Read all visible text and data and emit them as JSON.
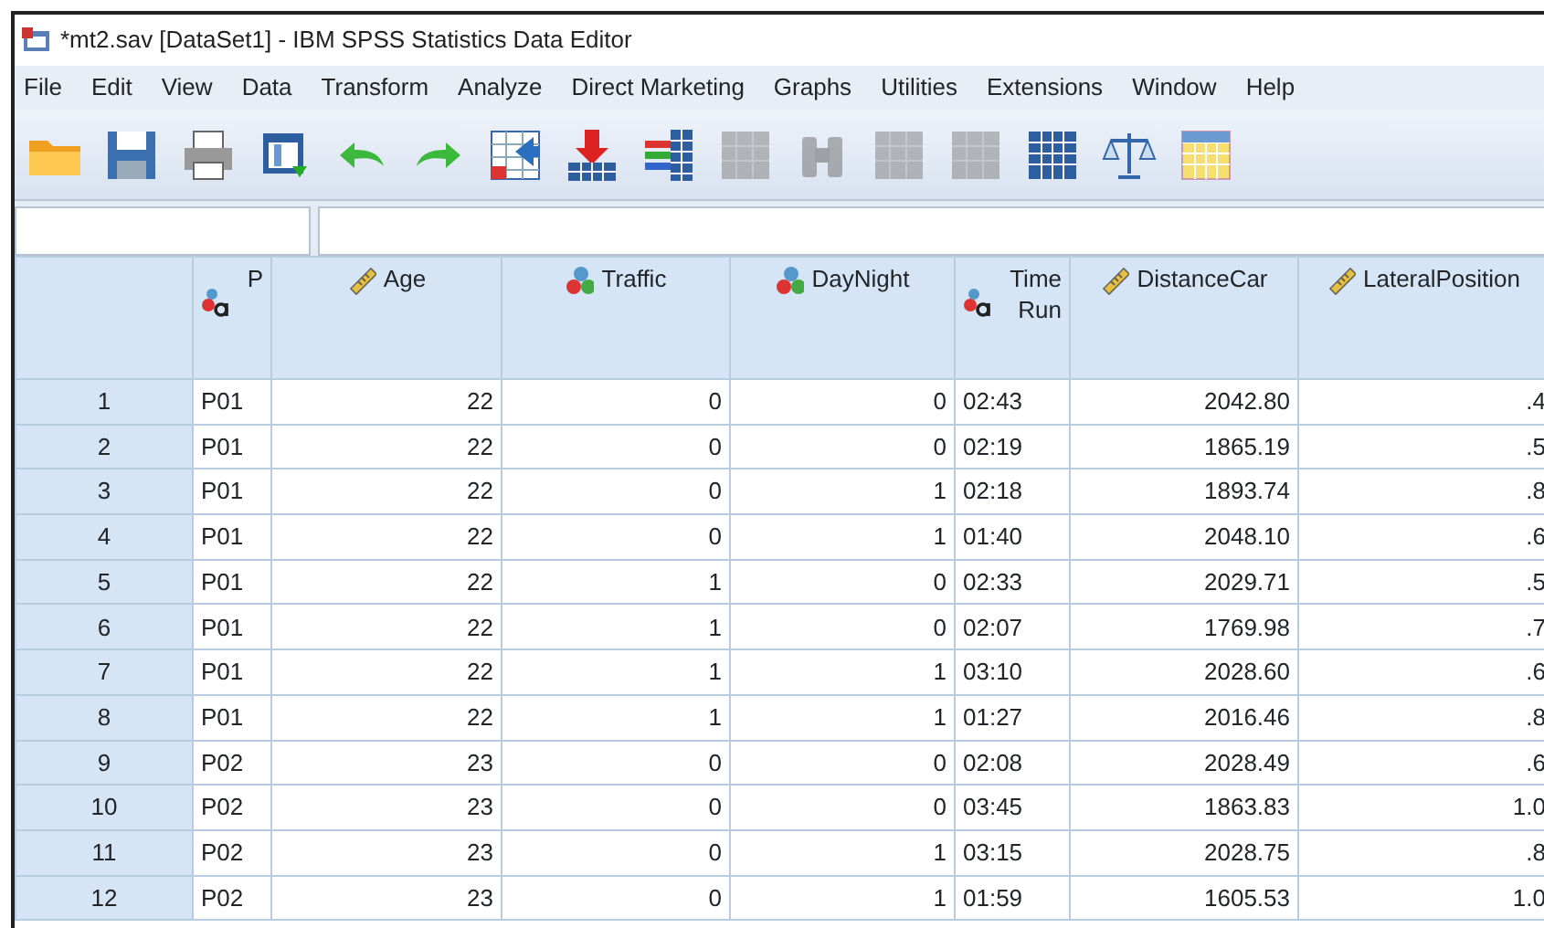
{
  "window": {
    "title": "*mt2.sav [DataSet1] - IBM SPSS Statistics Data Editor"
  },
  "menu": [
    "File",
    "Edit",
    "View",
    "Data",
    "Transform",
    "Analyze",
    "Direct Marketing",
    "Graphs",
    "Utilities",
    "Extensions",
    "Window",
    "Help"
  ],
  "toolbar": [
    {
      "kind": "folder",
      "disabled": false
    },
    {
      "kind": "save",
      "disabled": false
    },
    {
      "kind": "print",
      "disabled": false
    },
    {
      "kind": "dialog",
      "disabled": false
    },
    {
      "kind": "undo",
      "disabled": false
    },
    {
      "kind": "redo",
      "disabled": false
    },
    {
      "kind": "goto-case",
      "disabled": false
    },
    {
      "kind": "insert-cases",
      "disabled": false
    },
    {
      "kind": "variables",
      "disabled": false
    },
    {
      "kind": "grid",
      "disabled": true
    },
    {
      "kind": "find",
      "disabled": true
    },
    {
      "kind": "grid",
      "disabled": true
    },
    {
      "kind": "grid",
      "disabled": true
    },
    {
      "kind": "table",
      "disabled": false
    },
    {
      "kind": "scale",
      "disabled": false
    },
    {
      "kind": "yellow-grid",
      "disabled": false
    }
  ],
  "columns": [
    {
      "label": "P",
      "kind": "string"
    },
    {
      "label": "Age",
      "kind": "scale"
    },
    {
      "label": "Traffic",
      "kind": "nominal"
    },
    {
      "label": "DayNight",
      "kind": "nominal"
    },
    {
      "label": "Time Run",
      "kind": "string"
    },
    {
      "label": "DistanceCar",
      "kind": "scale"
    },
    {
      "label": "LateralPosition",
      "kind": "scale"
    }
  ],
  "rows": [
    {
      "number": "1",
      "cells": [
        "P01",
        "22",
        "0",
        "0",
        "02:43",
        "2042.80",
        ".4"
      ]
    },
    {
      "number": "2",
      "cells": [
        "P01",
        "22",
        "0",
        "0",
        "02:19",
        "1865.19",
        ".5"
      ]
    },
    {
      "number": "3",
      "cells": [
        "P01",
        "22",
        "0",
        "1",
        "02:18",
        "1893.74",
        ".8"
      ]
    },
    {
      "number": "4",
      "cells": [
        "P01",
        "22",
        "0",
        "1",
        "01:40",
        "2048.10",
        ".6"
      ]
    },
    {
      "number": "5",
      "cells": [
        "P01",
        "22",
        "1",
        "0",
        "02:33",
        "2029.71",
        ".5"
      ]
    },
    {
      "number": "6",
      "cells": [
        "P01",
        "22",
        "1",
        "0",
        "02:07",
        "1769.98",
        ".7"
      ]
    },
    {
      "number": "7",
      "cells": [
        "P01",
        "22",
        "1",
        "1",
        "03:10",
        "2028.60",
        ".6"
      ]
    },
    {
      "number": "8",
      "cells": [
        "P01",
        "22",
        "1",
        "1",
        "01:27",
        "2016.46",
        ".8"
      ]
    },
    {
      "number": "9",
      "cells": [
        "P02",
        "23",
        "0",
        "0",
        "02:08",
        "2028.49",
        ".6"
      ]
    },
    {
      "number": "10",
      "cells": [
        "P02",
        "23",
        "0",
        "0",
        "03:45",
        "1863.83",
        "1.0"
      ]
    },
    {
      "number": "11",
      "cells": [
        "P02",
        "23",
        "0",
        "1",
        "03:15",
        "2028.75",
        ".8"
      ]
    },
    {
      "number": "12",
      "cells": [
        "P02",
        "23",
        "0",
        "1",
        "01:59",
        "1605.53",
        "1.0"
      ]
    }
  ]
}
